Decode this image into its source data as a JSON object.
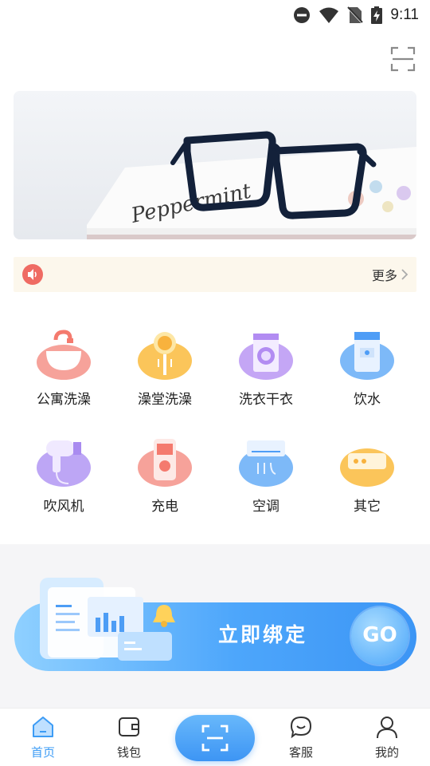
{
  "status_bar": {
    "time": "9:11"
  },
  "notice": {
    "more_label": "更多"
  },
  "services": [
    {
      "label": "公寓洗澡",
      "icon": "bathtub-icon",
      "color": "#f47a6e"
    },
    {
      "label": "澡堂洗澡",
      "icon": "shower-icon",
      "color": "#f8b23d"
    },
    {
      "label": "洗衣干衣",
      "icon": "washing-machine-icon",
      "color": "#b28cf2"
    },
    {
      "label": "饮水",
      "icon": "water-dispenser-icon",
      "color": "#4e9df6"
    },
    {
      "label": "吹风机",
      "icon": "hair-dryer-icon",
      "color": "#a98bf0"
    },
    {
      "label": "充电",
      "icon": "charging-icon",
      "color": "#f47a6e"
    },
    {
      "label": "空调",
      "icon": "air-conditioner-icon",
      "color": "#4e9df6"
    },
    {
      "label": "其它",
      "icon": "router-icon",
      "color": "#f8b23d"
    }
  ],
  "bind_card": {
    "label": "立即绑定",
    "go_label": "GO"
  },
  "tab_bar": {
    "items": [
      {
        "label": "首页",
        "icon": "home-icon",
        "active": true
      },
      {
        "label": "钱包",
        "icon": "wallet-icon",
        "active": false
      },
      {
        "label": "客服",
        "icon": "chat-icon",
        "active": false
      },
      {
        "label": "我的",
        "icon": "user-icon",
        "active": false
      }
    ],
    "scan_icon": "scan-icon"
  },
  "colors": {
    "accent": "#3d9cf5",
    "notice_bg": "#fcf7ec",
    "speaker": "#ef6b63"
  }
}
